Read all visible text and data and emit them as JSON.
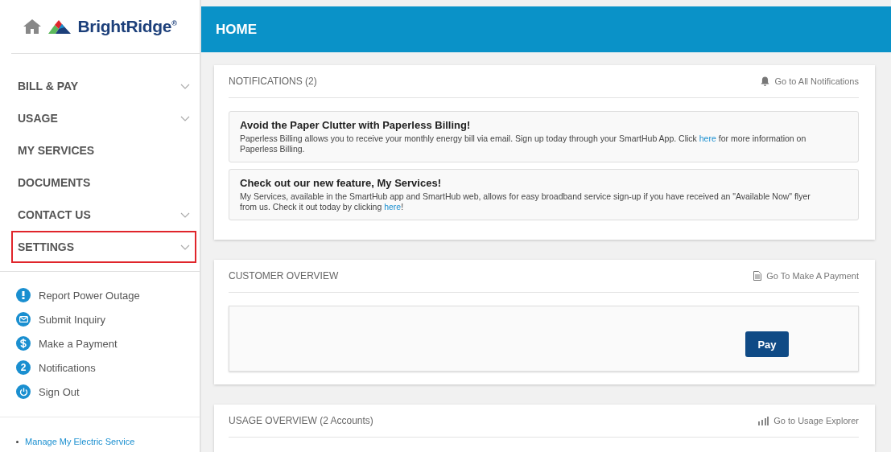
{
  "brand": {
    "name": "BrightRidge",
    "mark": "®"
  },
  "header": {
    "title": "HOME"
  },
  "nav": [
    {
      "label": "BILL & PAY",
      "expandable": true,
      "highlighted": false
    },
    {
      "label": "USAGE",
      "expandable": true,
      "highlighted": false
    },
    {
      "label": "MY SERVICES",
      "expandable": false,
      "highlighted": false
    },
    {
      "label": "DOCUMENTS",
      "expandable": false,
      "highlighted": false
    },
    {
      "label": "CONTACT US",
      "expandable": true,
      "highlighted": false
    },
    {
      "label": "SETTINGS",
      "expandable": true,
      "highlighted": true
    }
  ],
  "quick_links": [
    {
      "kind": "alert",
      "label": "Report Power Outage"
    },
    {
      "kind": "mail",
      "label": "Submit Inquiry"
    },
    {
      "kind": "dollar",
      "label": "Make a Payment"
    },
    {
      "kind": "count",
      "badge": "2",
      "label": "Notifications"
    },
    {
      "kind": "power",
      "label": "Sign Out"
    }
  ],
  "footer_links": [
    "Manage My Electric Service"
  ],
  "notifications": {
    "title": "NOTIFICATIONS (2)",
    "action": "Go to All Notifications",
    "items": [
      {
        "title": "Avoid the Paper Clutter with Paperless Billing!",
        "body": [
          {
            "kind": "text",
            "text": "Paperless Billing allows you to receive your monthly energy bill via email. Sign up today through your SmartHub App. Click "
          },
          {
            "kind": "link",
            "text": "here"
          },
          {
            "kind": "text",
            "text": " for more information on Paperless Billing."
          }
        ]
      },
      {
        "title": "Check out our new feature, My Services!",
        "body": [
          {
            "kind": "text",
            "text": "My Services, available in the SmartHub app and SmartHub web, allows for easy broadband service sign-up if you have received an \"Available Now\" flyer from us. Check it out today by clicking "
          },
          {
            "kind": "link",
            "text": "here"
          },
          {
            "kind": "text",
            "text": "!"
          }
        ]
      }
    ]
  },
  "customer_overview": {
    "title": "CUSTOMER OVERVIEW",
    "action": "Go To Make A Payment",
    "button": "Pay"
  },
  "usage_overview": {
    "title": "USAGE OVERVIEW (2 Accounts)",
    "action": "Go to Usage Explorer"
  }
}
